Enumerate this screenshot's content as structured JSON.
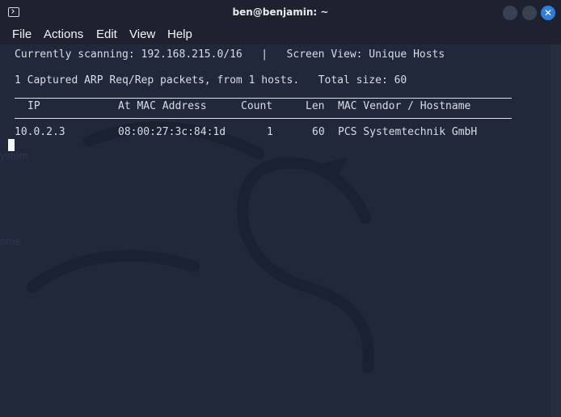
{
  "window": {
    "title": "ben@benjamin: ~"
  },
  "menu": {
    "items": [
      "File",
      "Actions",
      "Edit",
      "View",
      "Help"
    ]
  },
  "terminal": {
    "status_line": "Currently scanning: 192.168.215.0/16   |   Screen View: Unique Hosts",
    "summary_line": "1 Captured ARP Req/Rep packets, from 1 hosts.   Total size: 60",
    "table": {
      "headers": [
        "IP",
        "At MAC Address",
        "Count",
        "Len",
        "MAC Vendor / Hostname"
      ],
      "rows": [
        [
          "10.0.2.3",
          "08:00:27:3c:84:1d",
          "1",
          "60",
          "PCS Systemtechnik GmbH"
        ]
      ]
    }
  },
  "background": {
    "ghost_labels": [
      "ystem",
      "ome"
    ]
  },
  "colors": {
    "terminal_bg": "#202839",
    "titlebar_bg": "#1e2230",
    "close_button": "#2f7fd9",
    "text": "#d8dde6"
  }
}
